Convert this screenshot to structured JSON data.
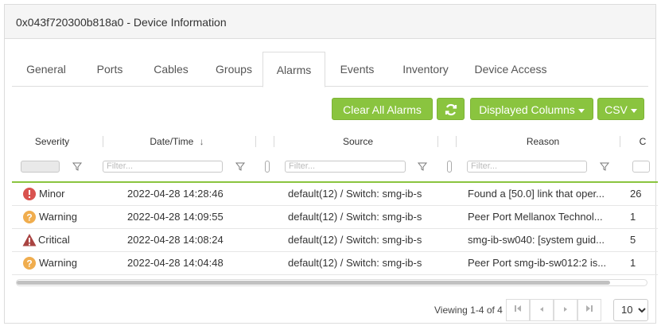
{
  "panel": {
    "title": "0x043f720300b818a0 - Device Information"
  },
  "tabs": [
    {
      "label": "General"
    },
    {
      "label": "Ports"
    },
    {
      "label": "Cables"
    },
    {
      "label": "Groups"
    },
    {
      "label": "Alarms"
    },
    {
      "label": "Events"
    },
    {
      "label": "Inventory"
    },
    {
      "label": "Device Access"
    }
  ],
  "active_tab": "Alarms",
  "toolbar": {
    "clear_label": "Clear All Alarms",
    "refresh_icon": "refresh-icon",
    "columns_label": "Displayed Columns",
    "csv_label": "CSV"
  },
  "columns": {
    "severity": "Severity",
    "datetime": "Date/Time",
    "sort_indicator": "↓",
    "source": "Source",
    "reason": "Reason",
    "count": "C"
  },
  "filters": {
    "placeholder": "Filter..."
  },
  "rows": [
    {
      "severity": "Minor",
      "icon": "minor-icon",
      "datetime": "2022-04-28 14:28:46",
      "source": "default(12) / Switch: smg-ib-s",
      "reason": "Found a [50.0] link that oper...",
      "count": "26"
    },
    {
      "severity": "Warning",
      "icon": "warning-icon",
      "datetime": "2022-04-28 14:09:55",
      "source": "default(12) / Switch: smg-ib-s",
      "reason": "Peer Port Mellanox Technol...",
      "count": "1"
    },
    {
      "severity": "Critical",
      "icon": "critical-icon",
      "datetime": "2022-04-28 14:08:24",
      "source": "default(12) / Switch: smg-ib-s",
      "reason": "smg-ib-sw040: [system guid...",
      "count": "5"
    },
    {
      "severity": "Warning",
      "icon": "warning-icon",
      "datetime": "2022-04-28 14:04:48",
      "source": "default(12) / Switch: smg-ib-s",
      "reason": "Peer Port smg-ib-sw012:2 is...",
      "count": "1"
    }
  ],
  "colors": {
    "accent": "#8ac43f",
    "minor": "#d9534f",
    "warning": "#f0ad4e",
    "critical": "#a94442"
  },
  "pager": {
    "viewing": "Viewing 1-4 of 4",
    "page_size": "10"
  }
}
